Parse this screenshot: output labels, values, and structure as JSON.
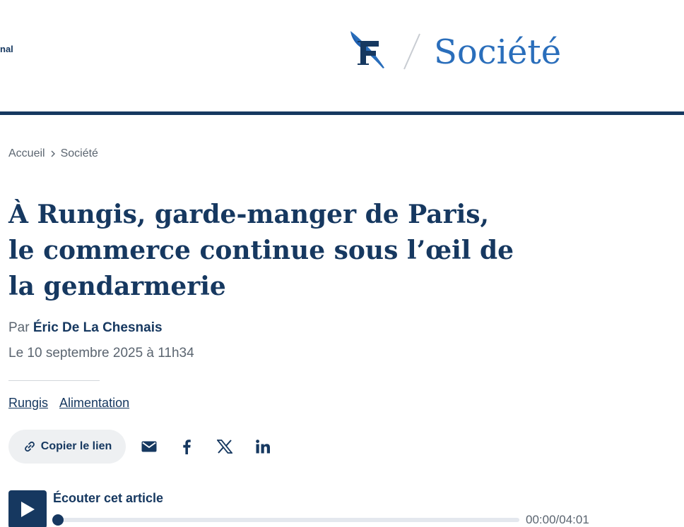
{
  "header": {
    "left_text": "nal",
    "section_title": "Société",
    "logo_icon": "le-figaro-logo-icon"
  },
  "colors": {
    "brand_navy": "#163860",
    "brand_blue": "#2a6ebb",
    "muted_text": "#5b6570"
  },
  "breadcrumb": {
    "items": [
      "Accueil",
      "Société"
    ],
    "separator_icon": "chevron-right-icon"
  },
  "article": {
    "title": "À Rungis, garde-manger de Paris, le commerce continue sous l’œil de la gendarmerie",
    "byline_prefix": "Par",
    "author": "Éric De La Chesnais",
    "date": "Le 10 septembre 2025 à 11h34",
    "tags": [
      "Rungis",
      "Alimentation"
    ]
  },
  "share": {
    "copy_link_label": "Copier le lien",
    "icons": [
      "link-icon",
      "mail-icon",
      "facebook-icon",
      "x-icon",
      "linkedin-icon"
    ]
  },
  "audio": {
    "label": "Écouter cet article",
    "time": "00:00/04:01",
    "progress": 0
  }
}
